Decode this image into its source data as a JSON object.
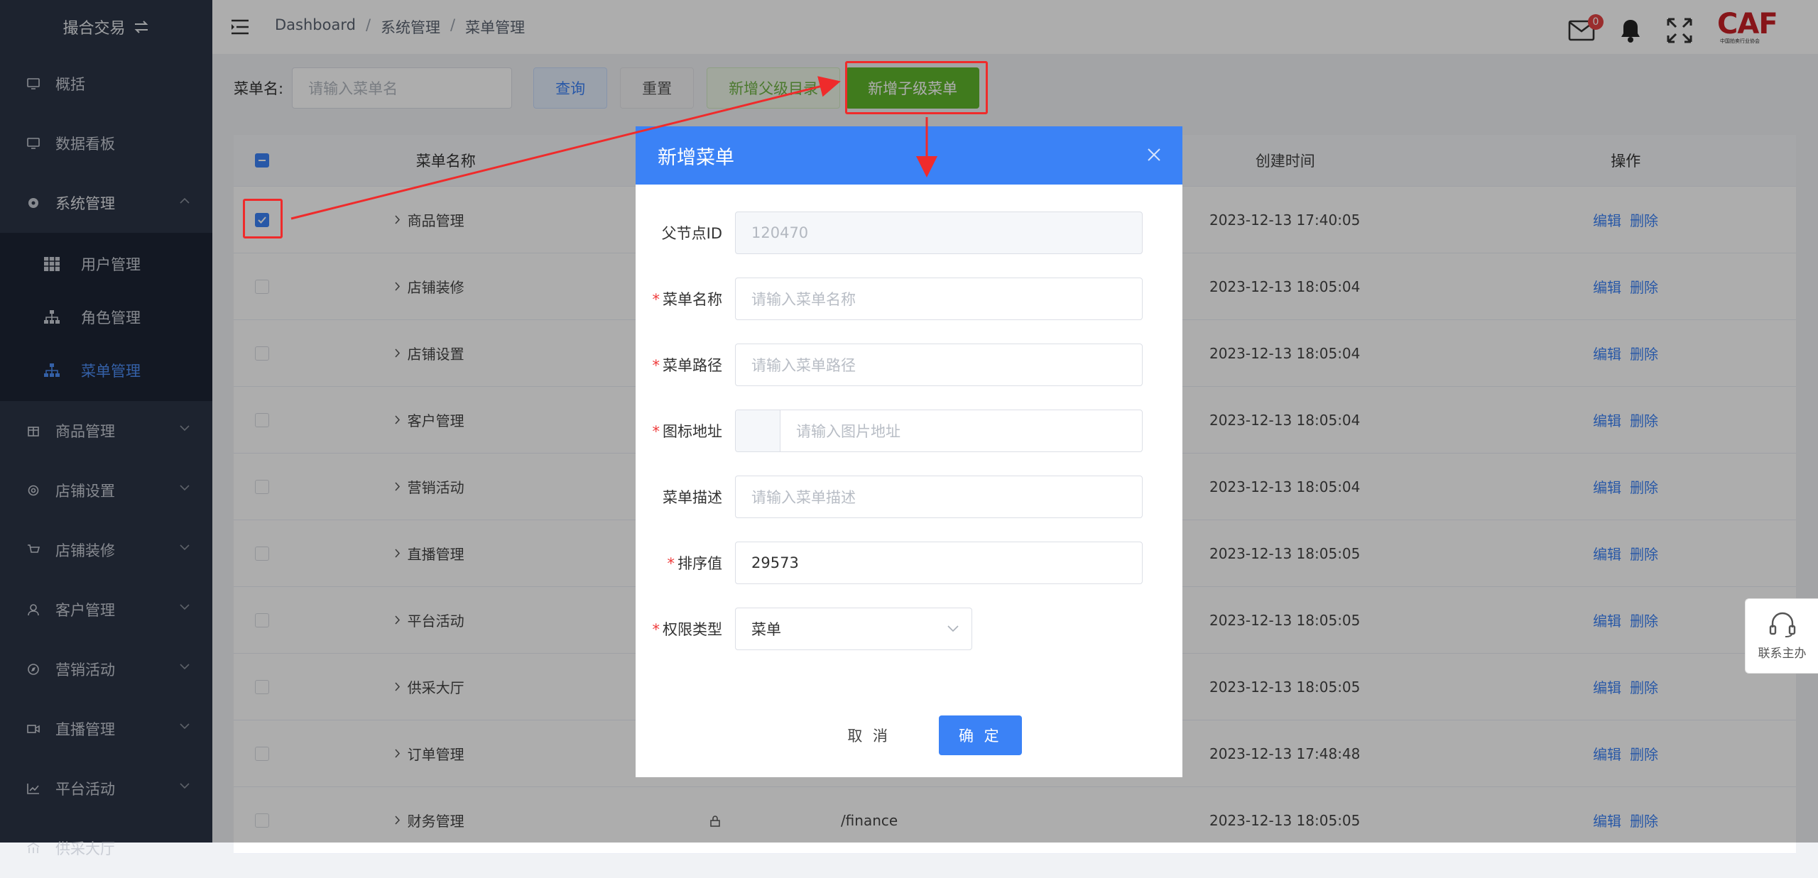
{
  "sidebar": {
    "brand": "撮合交易",
    "items": [
      {
        "label": "概括",
        "icon": "monitor-icon"
      },
      {
        "label": "数据看板",
        "icon": "monitor-icon"
      },
      {
        "label": "系统管理",
        "icon": "settings-circle-icon",
        "expanded": true
      },
      {
        "label": "商品管理",
        "icon": "box-icon"
      },
      {
        "label": "店铺设置",
        "icon": "gear-icon"
      },
      {
        "label": "店铺装修",
        "icon": "cart-icon"
      },
      {
        "label": "客户管理",
        "icon": "user-icon"
      },
      {
        "label": "营销活动",
        "icon": "compass-icon"
      },
      {
        "label": "直播管理",
        "icon": "video-icon"
      },
      {
        "label": "平台活动",
        "icon": "chart-icon"
      },
      {
        "label": "供采大厅",
        "icon": "hall-icon"
      }
    ],
    "submenu": [
      {
        "label": "用户管理",
        "icon": "grid-icon"
      },
      {
        "label": "角色管理",
        "icon": "org-icon"
      },
      {
        "label": "菜单管理",
        "icon": "org-icon",
        "active": true
      }
    ]
  },
  "header": {
    "breadcrumb": [
      "Dashboard",
      "系统管理",
      "菜单管理"
    ],
    "mail_badge": "0",
    "logo_text": "CAF",
    "logo_sub": "中国拍卖行业协会"
  },
  "toolbar": {
    "search_label": "菜单名:",
    "search_placeholder": "请输入菜单名",
    "query_label": "查询",
    "reset_label": "重置",
    "add_parent_label": "新增父级目录",
    "add_child_label": "新增子级菜单"
  },
  "table": {
    "headers": {
      "name": "菜单名称",
      "created": "创建时间",
      "ops": "操作"
    },
    "edit_label": "编辑",
    "delete_label": "删除",
    "rows": [
      {
        "name": "商品管理",
        "created": "2023-12-13 17:40:05",
        "checked": true
      },
      {
        "name": "店铺装修",
        "created": "2023-12-13 18:05:04"
      },
      {
        "name": "店铺设置",
        "created": "2023-12-13 18:05:04"
      },
      {
        "name": "客户管理",
        "created": "2023-12-13 18:05:04"
      },
      {
        "name": "营销活动",
        "created": "2023-12-13 18:05:04"
      },
      {
        "name": "直播管理",
        "created": "2023-12-13 18:05:05"
      },
      {
        "name": "平台活动",
        "created": "2023-12-13 18:05:05"
      },
      {
        "name": "供采大厅",
        "created": "2023-12-13 18:05:05"
      },
      {
        "name": "订单管理",
        "created": "2023-12-13 17:48:48"
      },
      {
        "name": "财务管理",
        "created": "2023-12-13 18:05:05",
        "path": "/finance"
      }
    ]
  },
  "help": {
    "label": "联系主办"
  },
  "dialog": {
    "title": "新增菜单",
    "fields": {
      "parent_id": {
        "label": "父节点ID",
        "value": "120470"
      },
      "menu_name": {
        "label": "菜单名称",
        "placeholder": "请输入菜单名称"
      },
      "menu_path": {
        "label": "菜单路径",
        "placeholder": "请输入菜单路径"
      },
      "icon_url": {
        "label": "图标地址",
        "placeholder": "请输入图片地址"
      },
      "menu_desc": {
        "label": "菜单描述",
        "placeholder": "请输入菜单描述"
      },
      "sort": {
        "label": "排序值",
        "value": "29573"
      },
      "perm_type": {
        "label": "权限类型",
        "value": "菜单"
      }
    },
    "cancel_label": "取 消",
    "ok_label": "确 定"
  },
  "colors": {
    "primary": "#3b82f6",
    "sidebar": "#2b3446",
    "success": "#5fb52b",
    "annotation": "#ef2b2b"
  }
}
